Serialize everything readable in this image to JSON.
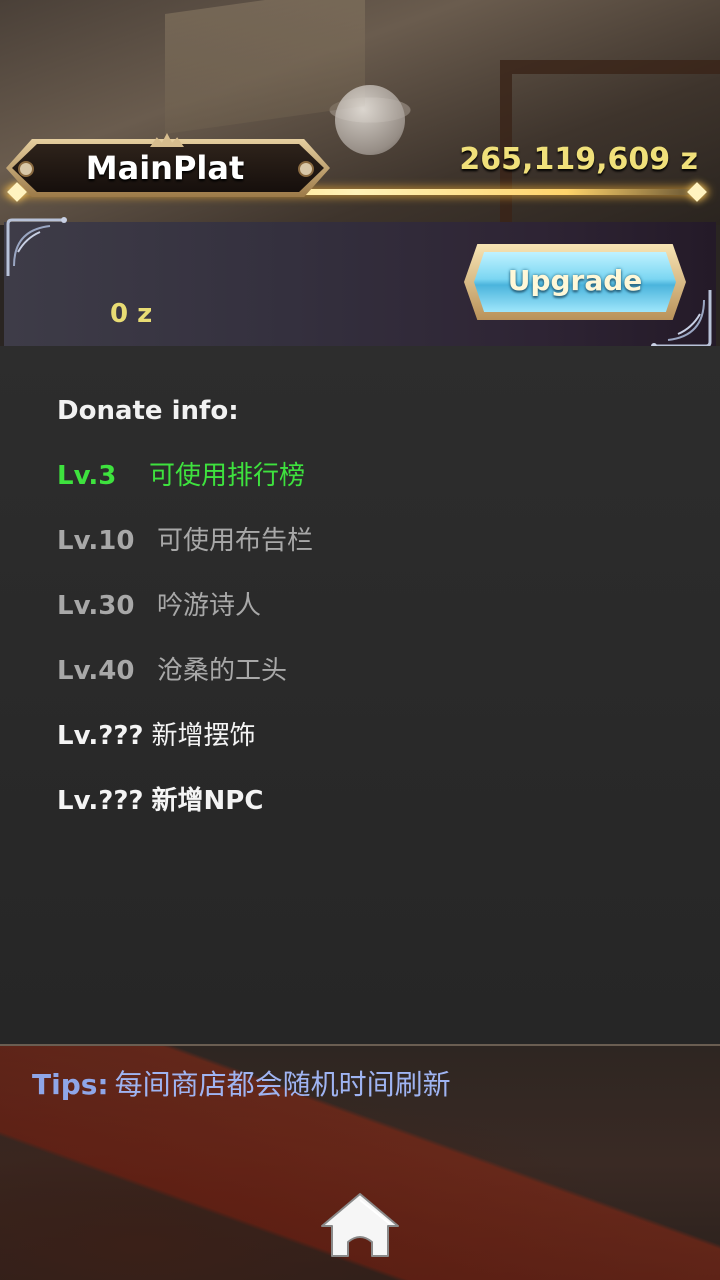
{
  "header": {
    "title": "MainPlat",
    "money": "265,119,609 z"
  },
  "donate_panel": {
    "donated_value": "0 z",
    "upgrade_label": "Upgrade"
  },
  "donate_info": {
    "heading": "Donate info:",
    "levels": [
      {
        "level": "Lv.3",
        "description": "可使用排行榜",
        "status": "unlocked"
      },
      {
        "level": "Lv.10",
        "description": "可使用布告栏",
        "status": "locked"
      },
      {
        "level": "Lv.30",
        "description": "吟游诗人",
        "status": "locked"
      },
      {
        "level": "Lv.40",
        "description": "沧桑的工头",
        "status": "locked"
      },
      {
        "level": "Lv.???",
        "description": "新增摆饰",
        "status": "secret"
      },
      {
        "level": "Lv.???",
        "description": "新增NPC",
        "status": "secret"
      }
    ]
  },
  "tips": {
    "label": "Tips:",
    "text": "每间商店都会随机时间刷新"
  },
  "colors": {
    "money": "#f0e07a",
    "unlocked": "#3ee23e",
    "locked": "#a8a8a8",
    "tips": "#9fb4f2"
  },
  "icons": {
    "home": "home-icon"
  }
}
